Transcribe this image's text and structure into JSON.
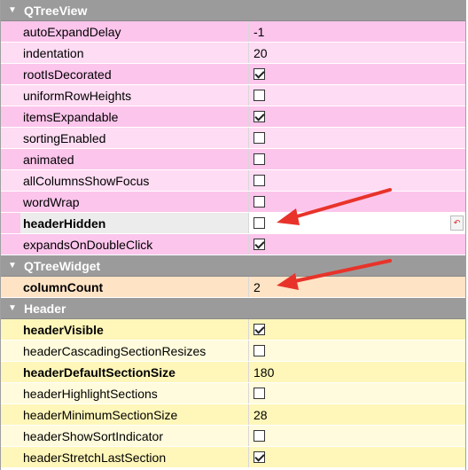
{
  "sections": [
    {
      "title": "QTreeView",
      "rows": [
        {
          "name": "autoExpandDelay",
          "value": "-1",
          "type": "text",
          "bold": false,
          "tone": "pink-a"
        },
        {
          "name": "indentation",
          "value": "20",
          "type": "text",
          "bold": false,
          "tone": "pink-b"
        },
        {
          "name": "rootIsDecorated",
          "value": true,
          "type": "check",
          "bold": false,
          "tone": "pink-a"
        },
        {
          "name": "uniformRowHeights",
          "value": false,
          "type": "check",
          "bold": false,
          "tone": "pink-b"
        },
        {
          "name": "itemsExpandable",
          "value": true,
          "type": "check",
          "bold": false,
          "tone": "pink-a"
        },
        {
          "name": "sortingEnabled",
          "value": false,
          "type": "check",
          "bold": false,
          "tone": "pink-b"
        },
        {
          "name": "animated",
          "value": false,
          "type": "check",
          "bold": false,
          "tone": "pink-a"
        },
        {
          "name": "allColumnsShowFocus",
          "value": false,
          "type": "check",
          "bold": false,
          "tone": "pink-b"
        },
        {
          "name": "wordWrap",
          "value": false,
          "type": "check",
          "bold": false,
          "tone": "pink-a"
        },
        {
          "name": "headerHidden",
          "value": false,
          "type": "check",
          "bold": true,
          "tone": "pink-b",
          "current": true
        },
        {
          "name": "expandsOnDoubleClick",
          "value": true,
          "type": "check",
          "bold": false,
          "tone": "pink-a"
        }
      ]
    },
    {
      "title": "QTreeWidget",
      "rows": [
        {
          "name": "columnCount",
          "value": "2",
          "type": "text",
          "bold": true,
          "tone": "peach"
        }
      ]
    },
    {
      "title": "Header",
      "rows": [
        {
          "name": "headerVisible",
          "value": true,
          "type": "check",
          "bold": true,
          "tone": "yel-a"
        },
        {
          "name": "headerCascadingSectionResizes",
          "value": false,
          "type": "check",
          "bold": false,
          "tone": "yel-b"
        },
        {
          "name": "headerDefaultSectionSize",
          "value": "180",
          "type": "text",
          "bold": true,
          "tone": "yel-a"
        },
        {
          "name": "headerHighlightSections",
          "value": false,
          "type": "check",
          "bold": false,
          "tone": "yel-b"
        },
        {
          "name": "headerMinimumSectionSize",
          "value": "28",
          "type": "text",
          "bold": false,
          "tone": "yel-a"
        },
        {
          "name": "headerShowSortIndicator",
          "value": false,
          "type": "check",
          "bold": false,
          "tone": "yel-b"
        },
        {
          "name": "headerStretchLastSection",
          "value": true,
          "type": "check",
          "bold": false,
          "tone": "yel-a"
        }
      ]
    }
  ],
  "icons": {
    "section_expander": "triangle-down-icon",
    "reset": "reset-icon"
  },
  "colors": {
    "section_header": "#9b9b9b",
    "annotation_arrow": "#e8332a"
  }
}
